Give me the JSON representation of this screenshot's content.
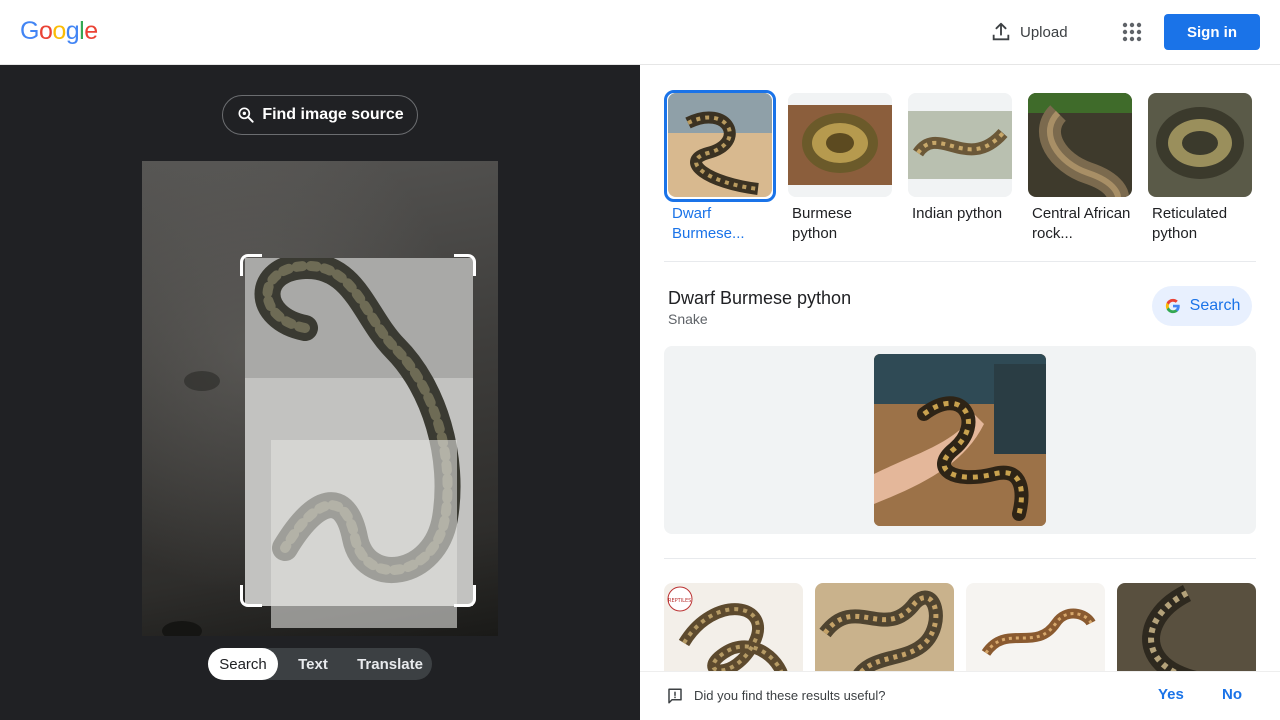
{
  "header": {
    "logo_letters": [
      {
        "ch": "G",
        "color": "#4285F4"
      },
      {
        "ch": "o",
        "color": "#EA4335"
      },
      {
        "ch": "o",
        "color": "#FBBC05"
      },
      {
        "ch": "g",
        "color": "#4285F4"
      },
      {
        "ch": "l",
        "color": "#34A853"
      },
      {
        "ch": "e",
        "color": "#EA4335"
      }
    ],
    "upload_label": "Upload",
    "upload_icon": "upload-icon",
    "apps_icon": "apps-grid-icon",
    "signin_label": "Sign in"
  },
  "lens": {
    "find_source_label": "Find image source",
    "find_source_icon": "lens-search-icon",
    "modes": [
      {
        "label": "Search",
        "active": true
      },
      {
        "label": "Text",
        "active": false
      },
      {
        "label": "Translate",
        "active": false
      }
    ]
  },
  "results": {
    "thumbnails": [
      {
        "label": "Dwarf Burmese...",
        "selected": true,
        "tone": "#c9a77c"
      },
      {
        "label": "Burmese python",
        "selected": false,
        "tone": "#8a6f3e"
      },
      {
        "label": "Indian python",
        "selected": false,
        "tone": "#a5a89a"
      },
      {
        "label": "Central African rock...",
        "selected": false,
        "tone": "#6b5a3f"
      },
      {
        "label": "Reticulated python",
        "selected": false,
        "tone": "#4a4a3a"
      }
    ],
    "entity": {
      "title": "Dwarf Burmese python",
      "subtitle": "Snake",
      "search_label": "Search"
    },
    "grid_tones": [
      "#e8e2d6",
      "#c7ae86",
      "#f3efea",
      "#5a5040"
    ],
    "grid_badge": "REPTILES",
    "feedback": {
      "question": "Did you find these results useful?",
      "yes": "Yes",
      "no": "No"
    }
  },
  "colors": {
    "accent": "#1a73e8",
    "dark_panel": "#202124"
  }
}
